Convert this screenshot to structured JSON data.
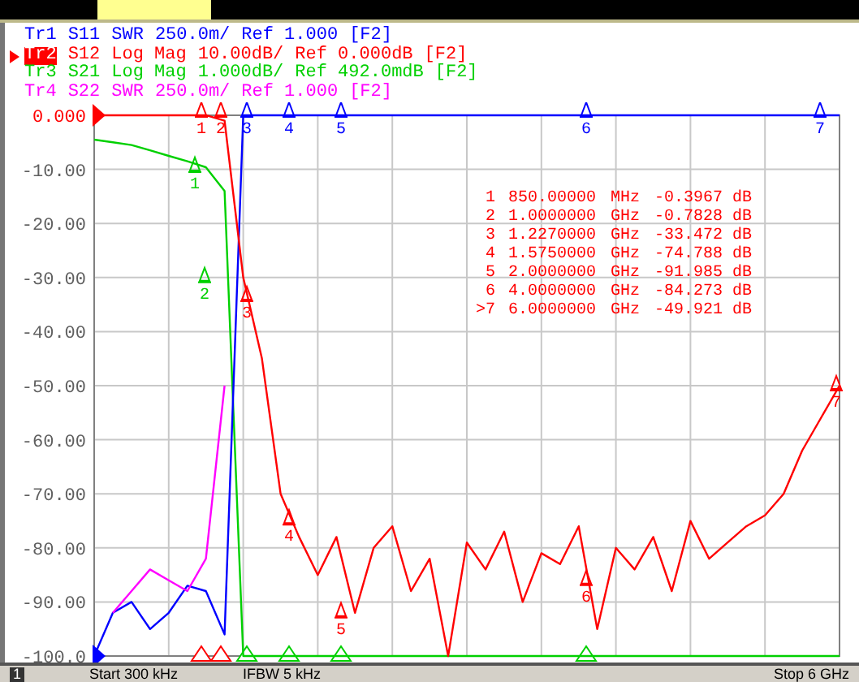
{
  "header": {
    "traces": [
      {
        "name": "Tr1",
        "param": "S11",
        "format": "SWR",
        "scale": "250.0m/",
        "ref": "Ref 1.000",
        "channel": "[F2]",
        "color": "#0000ff",
        "selected": false
      },
      {
        "name": "Tr2",
        "param": "S12",
        "format": "Log Mag",
        "scale": "10.00dB/",
        "ref": "Ref 0.000dB",
        "channel": "[F2]",
        "color": "#ff0000",
        "selected": true
      },
      {
        "name": "Tr3",
        "param": "S21",
        "format": "Log Mag",
        "scale": "1.000dB/",
        "ref": "Ref 492.0mdB",
        "channel": "[F2]",
        "color": "#00d000",
        "selected": false
      },
      {
        "name": "Tr4",
        "param": "S22",
        "format": "SWR",
        "scale": "250.0m/",
        "ref": "Ref 1.000",
        "channel": "[F2]",
        "color": "#ff00ff",
        "selected": false
      }
    ]
  },
  "plot": {
    "chart_data": {
      "type": "line",
      "grid": true,
      "ylim": [
        -100,
        0
      ],
      "yticks": [
        {
          "value": 0,
          "label": "0.000"
        },
        {
          "value": -10,
          "label": "-10.00"
        },
        {
          "value": -20,
          "label": "-20.00"
        },
        {
          "value": -30,
          "label": "-30.00"
        },
        {
          "value": -40,
          "label": "-40.00"
        },
        {
          "value": -50,
          "label": "-50.00"
        },
        {
          "value": -60,
          "label": "-60.00"
        },
        {
          "value": -70,
          "label": "-70.00"
        },
        {
          "value": -80,
          "label": "-80.00"
        },
        {
          "value": -90,
          "label": "-90.00"
        },
        {
          "value": -100,
          "label": "-100.0"
        }
      ],
      "series": [
        {
          "color": "#00d000",
          "values": [
            -4.5,
            -5,
            -5.5,
            -6.5,
            -7.5,
            -8.5,
            -9.6,
            -14,
            -100,
            -100,
            -100,
            -100,
            -100,
            -100,
            -100,
            -100,
            -100,
            -100,
            -100,
            -100,
            -100,
            -100,
            -100,
            -100,
            -100,
            -100,
            -100,
            -100,
            -100,
            -100,
            -100,
            -100,
            -100,
            -100,
            -100,
            -100,
            -100,
            -100,
            -100,
            -100,
            -100
          ]
        },
        {
          "color": "#0000ff",
          "values": [
            -100,
            -92,
            -90,
            -95,
            -92,
            -87,
            -88,
            -96,
            0,
            0,
            0,
            0,
            0,
            0,
            0,
            0,
            0,
            0,
            0,
            0,
            0,
            0,
            0,
            0,
            0,
            0,
            0,
            0,
            0,
            0,
            0,
            0,
            0,
            0,
            0,
            0,
            0,
            0,
            0,
            0,
            0
          ]
        },
        {
          "color": "#ff00ff",
          "values": [
            null,
            -92,
            -88,
            -84,
            -86,
            -88,
            -82,
            -50,
            null,
            null,
            null,
            null,
            null,
            null,
            null,
            null,
            null,
            null,
            null,
            null,
            null,
            null,
            null,
            null,
            null,
            null,
            null,
            null,
            null,
            null,
            null,
            null,
            null,
            null,
            null,
            null,
            null,
            null,
            null,
            null,
            null
          ]
        },
        {
          "color": "#ff0000",
          "values": [
            0,
            0,
            0,
            0,
            0,
            0,
            0,
            -1,
            -30,
            -45,
            -70,
            -78,
            -85,
            -78,
            -92,
            -80,
            -76,
            -88,
            -82,
            -100,
            -79,
            -84,
            -77,
            -90,
            -81,
            -83,
            -76,
            -95,
            -80,
            -84,
            -78,
            -88,
            -75,
            -82,
            -79,
            -76,
            -74,
            -70,
            -62,
            -56,
            -50
          ]
        }
      ]
    },
    "markers": [
      {
        "color": "#ff0000",
        "label": "1"
      },
      {
        "color": "#ff0000",
        "label": "2"
      },
      {
        "color": "#ff0000",
        "label": "3"
      },
      {
        "color": "#ff0000",
        "label": "4"
      },
      {
        "color": "#ff0000",
        "label": "5"
      },
      {
        "color": "#ff0000",
        "label": "6"
      },
      {
        "color": "#ff0000",
        "label": "7"
      },
      {
        "color": "#0000ff",
        "label": "3"
      },
      {
        "color": "#0000ff",
        "label": "4"
      },
      {
        "color": "#0000ff",
        "label": "5"
      },
      {
        "color": "#0000ff",
        "label": "6"
      },
      {
        "color": "#0000ff",
        "label": "7"
      },
      {
        "color": "#00d000",
        "label": "1"
      },
      {
        "color": "#00d000",
        "label": "2"
      }
    ],
    "marker_table": [
      {
        "label": "1",
        "frequency": "850.00000",
        "unit": "MHz",
        "value": "-0.3967",
        "value_unit": "dB"
      },
      {
        "label": "2",
        "frequency": "1.0000000",
        "unit": "GHz",
        "value": "-0.7828",
        "value_unit": "dB"
      },
      {
        "label": "3",
        "frequency": "1.2270000",
        "unit": "GHz",
        "value": "-33.472",
        "value_unit": "dB"
      },
      {
        "label": "4",
        "frequency": "1.5750000",
        "unit": "GHz",
        "value": "-74.788",
        "value_unit": "dB"
      },
      {
        "label": "5",
        "frequency": "2.0000000",
        "unit": "GHz",
        "value": "-91.985",
        "value_unit": "dB"
      },
      {
        "label": "6",
        "frequency": "4.0000000",
        "unit": "GHz",
        "value": "-84.273",
        "value_unit": "dB"
      },
      {
        "label": ">7",
        "frequency": "6.0000000",
        "unit": "GHz",
        "value": "-49.921",
        "value_unit": "dB"
      }
    ]
  },
  "status_bar": [
    "1",
    "Start 300 kHz",
    "IFBW 5 kHz",
    "Stop 6 GHz"
  ]
}
